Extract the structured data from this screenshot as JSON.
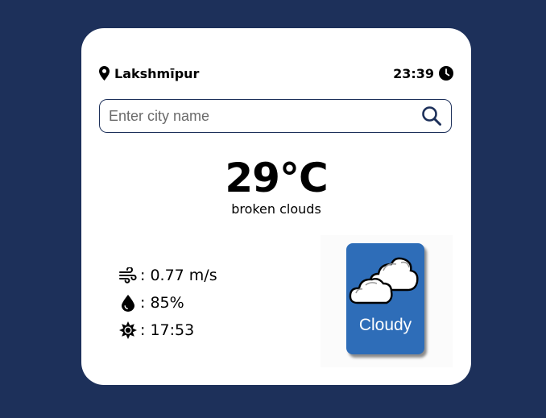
{
  "location": {
    "city": "Lakshmīpur",
    "icon": "map-pin-icon"
  },
  "clock": {
    "time": "23:39",
    "icon": "clock-icon"
  },
  "search": {
    "placeholder": "Enter city name",
    "value": "",
    "icon": "search-icon"
  },
  "current": {
    "temperature": "29°C",
    "description": "broken clouds"
  },
  "stats": {
    "wind": {
      "icon": "wind-icon",
      "text": ": 0.77 m/s"
    },
    "humidity": {
      "icon": "droplet-icon",
      "text": ": 85%"
    },
    "sunset": {
      "icon": "sun-icon",
      "text": ": 17:53"
    }
  },
  "weather_image": {
    "label": "Cloudy",
    "icon": "cloudy-icon"
  },
  "colors": {
    "background": "#1d305a",
    "card": "#ffffff",
    "accent": "#1d305a",
    "tile": "#2e6db8"
  }
}
